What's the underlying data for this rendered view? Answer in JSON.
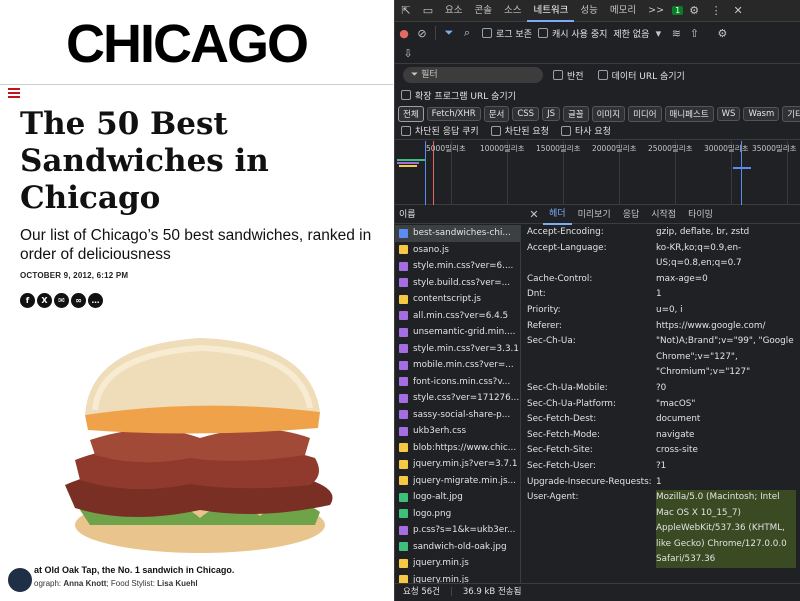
{
  "article": {
    "logo": "CHICAGO",
    "headline": "The 50 Best Sandwiches in Chicago",
    "subhead": "Our list of Chicago’s 50 best sandwiches, ranked in order of deliciousness",
    "dateline": "OCTOBER 9, 2012, 6:12 PM",
    "share_icons": [
      "facebook-icon",
      "x-icon",
      "email-icon",
      "link-icon",
      "comment-icon"
    ],
    "caption": "at Old Oak Tap, the No. 1 sandwich in Chicago.",
    "credit_prefix": "ograph: ",
    "credit_photographer": "Anna Knott",
    "credit_suffix": "; Food Stylist: ",
    "credit_stylist": "Lisa Kuehl"
  },
  "devtools": {
    "tabs": [
      {
        "label": "요소",
        "active": false
      },
      {
        "label": "콘솔",
        "active": false
      },
      {
        "label": "소스",
        "active": false
      },
      {
        "label": "네트워크",
        "active": true
      },
      {
        "label": "성능",
        "active": false
      },
      {
        "label": "메모리",
        "active": false
      }
    ],
    "more_tabs": ">>",
    "issues_count": "1",
    "toolbar": {
      "preserve_log": "로그 보존",
      "disable_cache": "캐시 사용 중지",
      "throttling": "제한 없음"
    },
    "filter": {
      "placeholder": "필터",
      "invert": "반전",
      "hide_data_urls": "데이터 URL 숨기기",
      "hide_extension_urls": "확장 프로그램 URL 숨기기"
    },
    "types": [
      "전체",
      "Fetch/XHR",
      "문서",
      "CSS",
      "JS",
      "글꼴",
      "이미지",
      "미디어",
      "매니페스트",
      "WS",
      "Wasm",
      "기타"
    ],
    "block": {
      "blocked_cookies": "차단된 응답 쿠키",
      "blocked_requests": "차단된 요청",
      "third_party": "타사 요청"
    },
    "timeline_ticks": [
      "5000밀리초",
      "10000밀리초",
      "15000밀리초",
      "20000밀리초",
      "25000밀리초",
      "30000밀리초",
      "35000밀리초"
    ],
    "name_header": "이름",
    "requests": [
      {
        "name": "best-sandwiches-chi...",
        "type": "doc"
      },
      {
        "name": "osano.js",
        "type": "js"
      },
      {
        "name": "style.min.css?ver=6....",
        "type": "css"
      },
      {
        "name": "style.build.css?ver=...",
        "type": "css"
      },
      {
        "name": "contentscript.js",
        "type": "js"
      },
      {
        "name": "all.min.css?ver=6.4.5",
        "type": "css"
      },
      {
        "name": "unsemantic-grid.min....",
        "type": "css"
      },
      {
        "name": "style.min.css?ver=3.3.1",
        "type": "css"
      },
      {
        "name": "mobile.min.css?ver=...",
        "type": "css"
      },
      {
        "name": "font-icons.min.css?v...",
        "type": "css"
      },
      {
        "name": "style.css?ver=171276...",
        "type": "css"
      },
      {
        "name": "sassy-social-share-p...",
        "type": "css"
      },
      {
        "name": "ukb3erh.css",
        "type": "css"
      },
      {
        "name": "blob:https://www.chic...",
        "type": "js"
      },
      {
        "name": "jquery.min.js?ver=3.7.1",
        "type": "js"
      },
      {
        "name": "jquery-migrate.min.js...",
        "type": "js"
      },
      {
        "name": "logo-alt.jpg",
        "type": "img"
      },
      {
        "name": "logo.png",
        "type": "img"
      },
      {
        "name": "p.css?s=1&k=ukb3er...",
        "type": "css"
      },
      {
        "name": "sandwich-old-oak.jpg",
        "type": "img"
      },
      {
        "name": "jquery.min.js",
        "type": "js"
      },
      {
        "name": "jquery.min.js",
        "type": "js"
      }
    ],
    "detail_tabs": [
      {
        "label": "헤더",
        "active": true
      },
      {
        "label": "미리보기",
        "active": false
      },
      {
        "label": "응답",
        "active": false
      },
      {
        "label": "시작점",
        "active": false
      },
      {
        "label": "타이밍",
        "active": false
      }
    ],
    "headers": [
      {
        "key": "Accept-Encoding:",
        "value": "gzip, deflate, br, zstd"
      },
      {
        "key": "Accept-Language:",
        "value": "ko-KR,ko;q=0.9,en-US;q=0.8,en;q=0.7"
      },
      {
        "key": "Cache-Control:",
        "value": "max-age=0"
      },
      {
        "key": "Dnt:",
        "value": "1"
      },
      {
        "key": "Priority:",
        "value": "u=0, i"
      },
      {
        "key": "Referer:",
        "value": "https://www.google.com/"
      },
      {
        "key": "Sec-Ch-Ua:",
        "value": "\"Not)A;Brand\";v=\"99\", \"Google Chrome\";v=\"127\", \"Chromium\";v=\"127\""
      },
      {
        "key": "Sec-Ch-Ua-Mobile:",
        "value": "?0"
      },
      {
        "key": "Sec-Ch-Ua-Platform:",
        "value": "\"macOS\""
      },
      {
        "key": "Sec-Fetch-Dest:",
        "value": "document"
      },
      {
        "key": "Sec-Fetch-Mode:",
        "value": "navigate"
      },
      {
        "key": "Sec-Fetch-Site:",
        "value": "cross-site"
      },
      {
        "key": "Sec-Fetch-User:",
        "value": "?1"
      },
      {
        "key": "Upgrade-Insecure-Requests:",
        "value": "1"
      },
      {
        "key": "User-Agent:",
        "value": "Mozilla/5.0 (Macintosh; Intel Mac OS X 10_15_7) AppleWebKit/537.36 (KHTML, like Gecko) Chrome/127.0.0.0 Safari/537.36",
        "highlight": true
      }
    ],
    "status": {
      "requests": "요청 56건",
      "transferred": "36.9 kB 전송됨"
    },
    "colors": {
      "css": "#a56de2",
      "js": "#f6c945",
      "img": "#3ec07a",
      "doc": "#5a8cf2",
      "accent": "#7cacf8"
    }
  }
}
